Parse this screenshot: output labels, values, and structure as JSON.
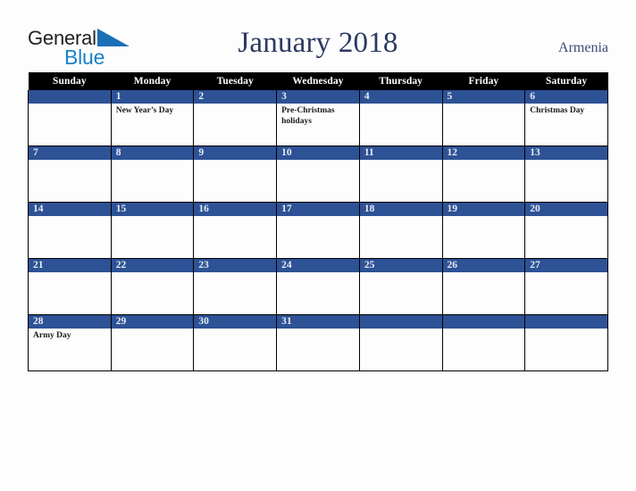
{
  "brand": {
    "word1": "General",
    "word2": "Blue",
    "triangle_color": "#1b6fb5",
    "word1_color": "#231f20",
    "word2_color": "#1b81c6"
  },
  "header": {
    "title": "January 2018",
    "country": "Armenia",
    "title_color": "#2b3a61"
  },
  "calendar": {
    "weekday_headers": [
      "Sunday",
      "Monday",
      "Tuesday",
      "Wednesday",
      "Thursday",
      "Friday",
      "Saturday"
    ],
    "header_bg": "#000000",
    "daynum_bg": "#2d5295",
    "daynum_color": "#e8ecf5",
    "weeks": [
      [
        {
          "day": "",
          "events": ""
        },
        {
          "day": "1",
          "events": "New Year’s Day"
        },
        {
          "day": "2",
          "events": ""
        },
        {
          "day": "3",
          "events": "Pre-Christmas holidays"
        },
        {
          "day": "4",
          "events": ""
        },
        {
          "day": "5",
          "events": ""
        },
        {
          "day": "6",
          "events": "Christmas Day"
        }
      ],
      [
        {
          "day": "7",
          "events": ""
        },
        {
          "day": "8",
          "events": ""
        },
        {
          "day": "9",
          "events": ""
        },
        {
          "day": "10",
          "events": ""
        },
        {
          "day": "11",
          "events": ""
        },
        {
          "day": "12",
          "events": ""
        },
        {
          "day": "13",
          "events": ""
        }
      ],
      [
        {
          "day": "14",
          "events": ""
        },
        {
          "day": "15",
          "events": ""
        },
        {
          "day": "16",
          "events": ""
        },
        {
          "day": "17",
          "events": ""
        },
        {
          "day": "18",
          "events": ""
        },
        {
          "day": "19",
          "events": ""
        },
        {
          "day": "20",
          "events": ""
        }
      ],
      [
        {
          "day": "21",
          "events": ""
        },
        {
          "day": "22",
          "events": ""
        },
        {
          "day": "23",
          "events": ""
        },
        {
          "day": "24",
          "events": ""
        },
        {
          "day": "25",
          "events": ""
        },
        {
          "day": "26",
          "events": ""
        },
        {
          "day": "27",
          "events": ""
        }
      ],
      [
        {
          "day": "28",
          "events": "Army Day"
        },
        {
          "day": "29",
          "events": ""
        },
        {
          "day": "30",
          "events": ""
        },
        {
          "day": "31",
          "events": ""
        },
        {
          "day": "",
          "events": ""
        },
        {
          "day": "",
          "events": ""
        },
        {
          "day": "",
          "events": ""
        }
      ]
    ]
  }
}
